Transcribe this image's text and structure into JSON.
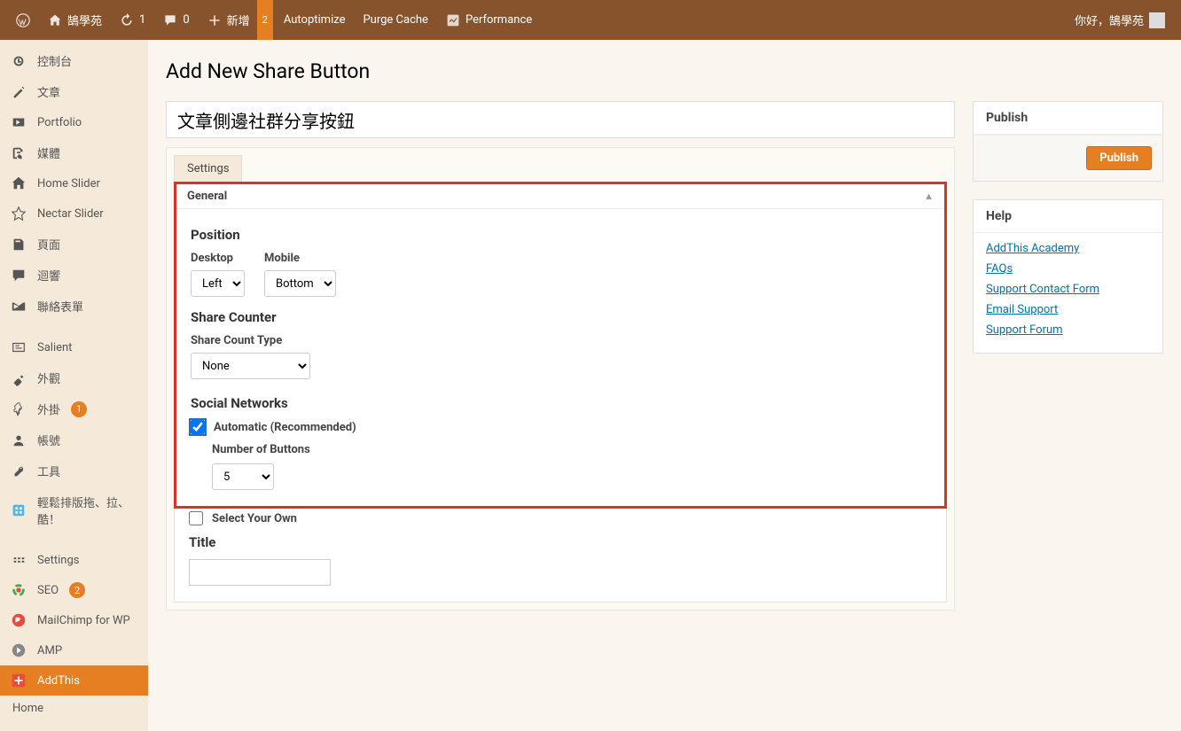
{
  "adminbar": {
    "site_name": "鵠學苑",
    "updates": "1",
    "comments": "0",
    "new_label": "新增",
    "new_badge": "2",
    "items": [
      "Autoptimize",
      "Purge Cache",
      "Performance"
    ],
    "greeting": "你好，鵠學苑"
  },
  "sidebar": {
    "items": [
      {
        "label": "控制台"
      },
      {
        "label": "文章"
      },
      {
        "label": "Portfolio"
      },
      {
        "label": "媒體"
      },
      {
        "label": "Home Slider"
      },
      {
        "label": "Nectar Slider"
      },
      {
        "label": "頁面"
      },
      {
        "label": "迴響"
      },
      {
        "label": "聯絡表單"
      },
      {
        "label": "Salient"
      },
      {
        "label": "外觀"
      },
      {
        "label": "外掛",
        "badge": "1"
      },
      {
        "label": "帳號"
      },
      {
        "label": "工具"
      },
      {
        "label": "輕鬆排版拖、拉、酷！"
      },
      {
        "label": "Settings"
      },
      {
        "label": "SEO",
        "badge": "2"
      },
      {
        "label": "MailChimp for WP"
      },
      {
        "label": "AMP"
      },
      {
        "label": "AddThis",
        "active": true
      }
    ],
    "submenu": "Home"
  },
  "page": {
    "title": "Add New Share Button",
    "input_value": "文章側邊社群分享按鈕",
    "tab": "Settings"
  },
  "general": {
    "header": "General",
    "position_heading": "Position",
    "desktop_label": "Desktop",
    "mobile_label": "Mobile",
    "desktop_value": "Left",
    "mobile_value": "Bottom",
    "share_counter_heading": "Share Counter",
    "share_count_type_label": "Share Count Type",
    "share_count_type_value": "None",
    "social_networks_heading": "Social Networks",
    "automatic_label": "Automatic (Recommended)",
    "number_of_buttons_label": "Number of Buttons",
    "number_of_buttons_value": "5",
    "select_own_label": "Select Your Own",
    "title_label": "Title",
    "title_value": ""
  },
  "publish": {
    "header": "Publish",
    "button": "Publish"
  },
  "help": {
    "header": "Help",
    "links": [
      "AddThis Academy",
      "FAQs",
      "Support Contact Form",
      "Email Support",
      "Support Forum"
    ]
  }
}
